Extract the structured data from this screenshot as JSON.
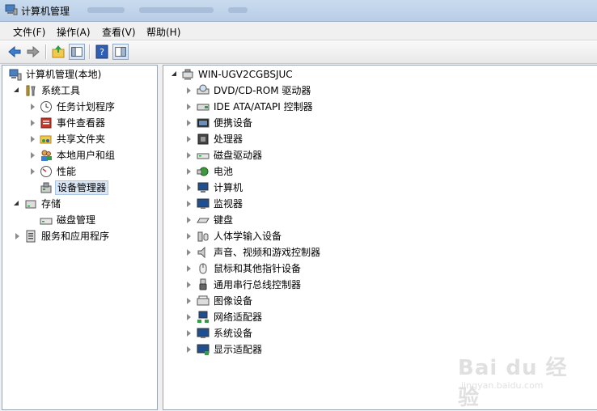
{
  "window": {
    "title": "计算机管理"
  },
  "menu": [
    "文件(F)",
    "操作(A)",
    "查看(V)",
    "帮助(H)"
  ],
  "toolbar": {
    "icons": [
      "back-icon",
      "forward-icon",
      "up-folder-icon",
      "show-hide-tree-icon",
      "help-icon",
      "properties-icon"
    ]
  },
  "left_tree": [
    {
      "label": "计算机管理(本地)",
      "icon": "computer-management-icon",
      "expander": "none",
      "level": 0
    },
    {
      "label": "系统工具",
      "icon": "tools-icon",
      "expander": "open",
      "level": 1
    },
    {
      "label": "任务计划程序",
      "icon": "clock-icon",
      "expander": "closed",
      "level": 2
    },
    {
      "label": "事件查看器",
      "icon": "event-viewer-icon",
      "expander": "closed",
      "level": 2
    },
    {
      "label": "共享文件夹",
      "icon": "shared-folder-icon",
      "expander": "closed",
      "level": 2
    },
    {
      "label": "本地用户和组",
      "icon": "users-icon",
      "expander": "closed",
      "level": 2
    },
    {
      "label": "性能",
      "icon": "performance-icon",
      "expander": "closed",
      "level": 2
    },
    {
      "label": "设备管理器",
      "icon": "device-manager-icon",
      "expander": "none",
      "level": 2,
      "selected": true
    },
    {
      "label": "存储",
      "icon": "storage-icon",
      "expander": "open",
      "level": 1
    },
    {
      "label": "磁盘管理",
      "icon": "disk-management-icon",
      "expander": "none",
      "level": 2
    },
    {
      "label": "服务和应用程序",
      "icon": "services-icon",
      "expander": "closed",
      "level": 1
    }
  ],
  "device_tree": {
    "root": {
      "label": "WIN-UGV2CGBSJUC",
      "icon": "computer-icon"
    },
    "categories": [
      {
        "label": "DVD/CD-ROM 驱动器",
        "icon": "dvd-drive-icon"
      },
      {
        "label": "IDE ATA/ATAPI 控制器",
        "icon": "ide-controller-icon"
      },
      {
        "label": "便携设备",
        "icon": "portable-device-icon"
      },
      {
        "label": "处理器",
        "icon": "processor-icon"
      },
      {
        "label": "磁盘驱动器",
        "icon": "disk-drive-icon"
      },
      {
        "label": "电池",
        "icon": "battery-icon"
      },
      {
        "label": "计算机",
        "icon": "computer-icon"
      },
      {
        "label": "监视器",
        "icon": "monitor-icon"
      },
      {
        "label": "键盘",
        "icon": "keyboard-icon"
      },
      {
        "label": "人体学输入设备",
        "icon": "hid-icon"
      },
      {
        "label": "声音、视频和游戏控制器",
        "icon": "sound-icon"
      },
      {
        "label": "鼠标和其他指针设备",
        "icon": "mouse-icon"
      },
      {
        "label": "通用串行总线控制器",
        "icon": "usb-icon"
      },
      {
        "label": "图像设备",
        "icon": "imaging-device-icon"
      },
      {
        "label": "网络适配器",
        "icon": "network-adapter-icon"
      },
      {
        "label": "系统设备",
        "icon": "system-device-icon"
      },
      {
        "label": "显示适配器",
        "icon": "display-adapter-icon"
      }
    ]
  },
  "watermark": {
    "main": "Bai du 经验",
    "sub": "jingyan.baidu.com"
  }
}
